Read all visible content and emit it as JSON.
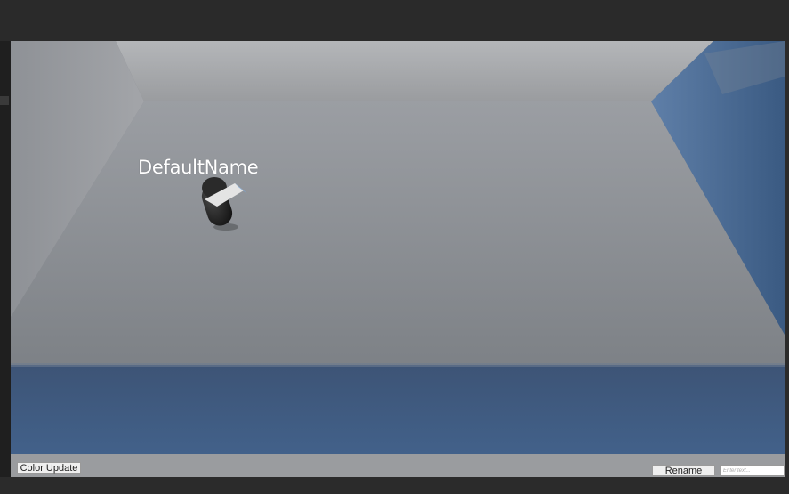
{
  "game": {
    "player_name": "DefaultName"
  },
  "controls": {
    "color_update_label": "Color Update",
    "rename_label": "Rename",
    "name_input_placeholder": "Enter text...",
    "name_input_value": ""
  },
  "colors": {
    "editor_background": "#2b2b2b",
    "floor": "#8a8d92",
    "back_wall": "#a9abaf",
    "right_wall": "#3f5f86",
    "front_wall": "#3c5579",
    "player_body": "#1c1c1c",
    "player_visor": "#e8e8e8"
  }
}
